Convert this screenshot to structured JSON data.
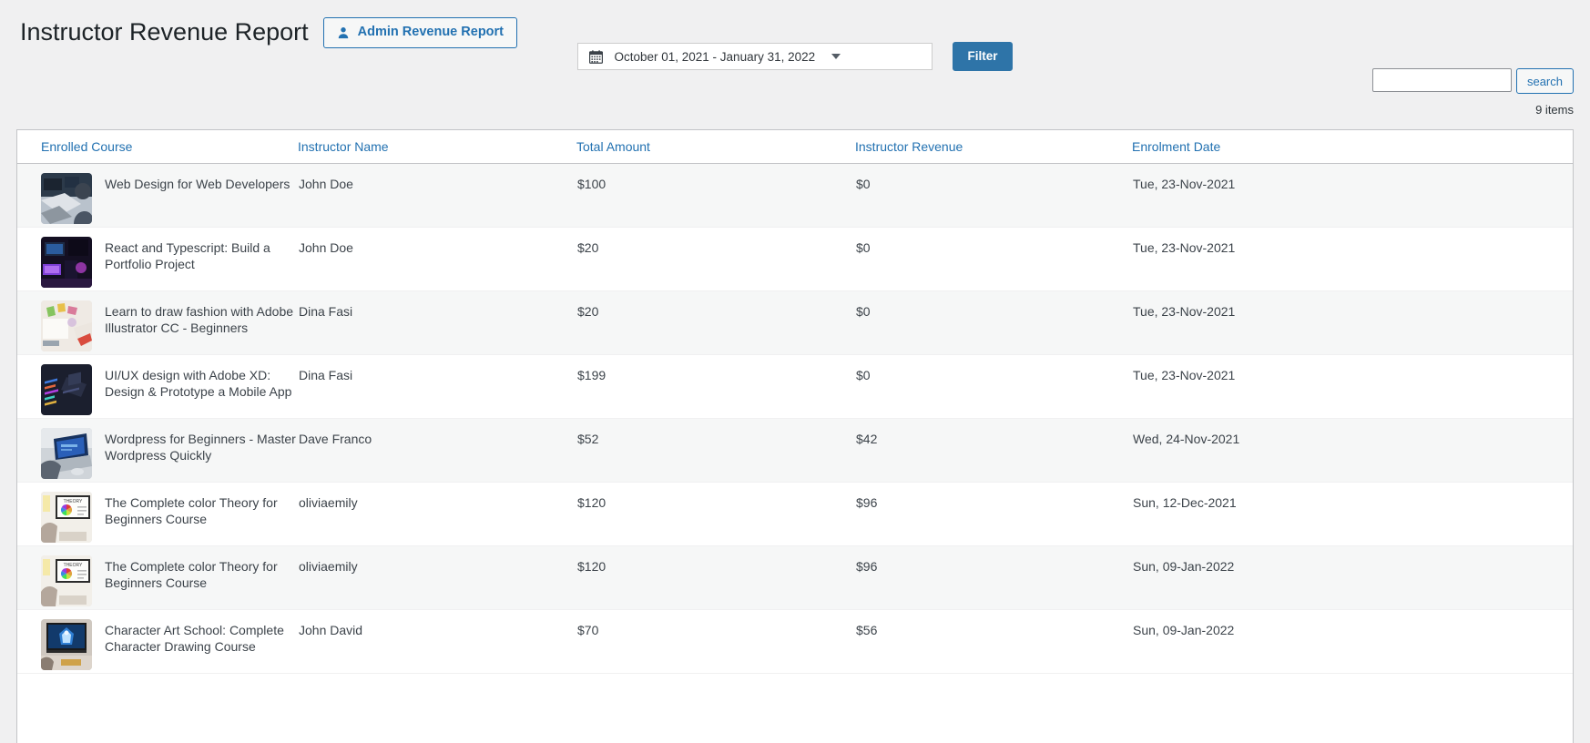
{
  "header": {
    "title": "Instructor Revenue Report",
    "admin_button_label": "Admin Revenue Report",
    "admin_button_icon": "user-icon"
  },
  "filter": {
    "date_range": "October 01, 2021 - January 31, 2022",
    "calendar_icon": "calendar-icon",
    "caret_icon": "chevron-down-icon",
    "filter_button_label": "Filter"
  },
  "search": {
    "value": "",
    "placeholder": "",
    "button_label": "search"
  },
  "items_count": "9 items",
  "table": {
    "columns": [
      "Enrolled Course",
      "Instructor Name",
      "Total Amount",
      "Instructor Revenue",
      "Enrolment Date"
    ],
    "rows": [
      {
        "course": "Web Design for Web Developers",
        "instructor": "John Doe",
        "total": "$100",
        "revenue": "$0",
        "date": "Tue, 23-Nov-2021",
        "thumb": "desk-laptops"
      },
      {
        "course": "React and Typescript: Build a Portfolio Project",
        "instructor": "John Doe",
        "total": "$20",
        "revenue": "$0",
        "date": "Tue, 23-Nov-2021",
        "thumb": "neon-desk"
      },
      {
        "course": "Learn to draw fashion with Adobe Illustrator CC - Beginners",
        "instructor": "Dina Fasi",
        "total": "$20",
        "revenue": "$0",
        "date": "Tue, 23-Nov-2021",
        "thumb": "sketch-table"
      },
      {
        "course": "UI/UX design with Adobe XD: Design & Prototype a Mobile App",
        "instructor": "Dina Fasi",
        "total": "$199",
        "revenue": "$0",
        "date": "Tue, 23-Nov-2021",
        "thumb": "dark-isometric"
      },
      {
        "course": "Wordpress for Beginners - Master Wordpress Quickly",
        "instructor": "Dave Franco",
        "total": "$52",
        "revenue": "$42",
        "date": "Wed, 24-Nov-2021",
        "thumb": "laptop-blue-screen"
      },
      {
        "course": "The Complete color Theory for Beginners Course",
        "instructor": "oliviaemily",
        "total": "$120",
        "revenue": "$96",
        "date": "Sun, 12-Dec-2021",
        "thumb": "color-wheel-monitor"
      },
      {
        "course": "The Complete color Theory for Beginners Course",
        "instructor": "oliviaemily",
        "total": "$120",
        "revenue": "$96",
        "date": "Sun, 09-Jan-2022",
        "thumb": "color-wheel-monitor"
      },
      {
        "course": "Character Art School: Complete Character Drawing Course",
        "instructor": "John David",
        "total": "$70",
        "revenue": "$56",
        "date": "Sun, 09-Jan-2022",
        "thumb": "character-monitor"
      }
    ]
  },
  "colors": {
    "link": "#2271b1",
    "filter_button": "#2e74a8",
    "page_bg": "#f0f0f1",
    "row_stripe": "#f6f7f7"
  }
}
